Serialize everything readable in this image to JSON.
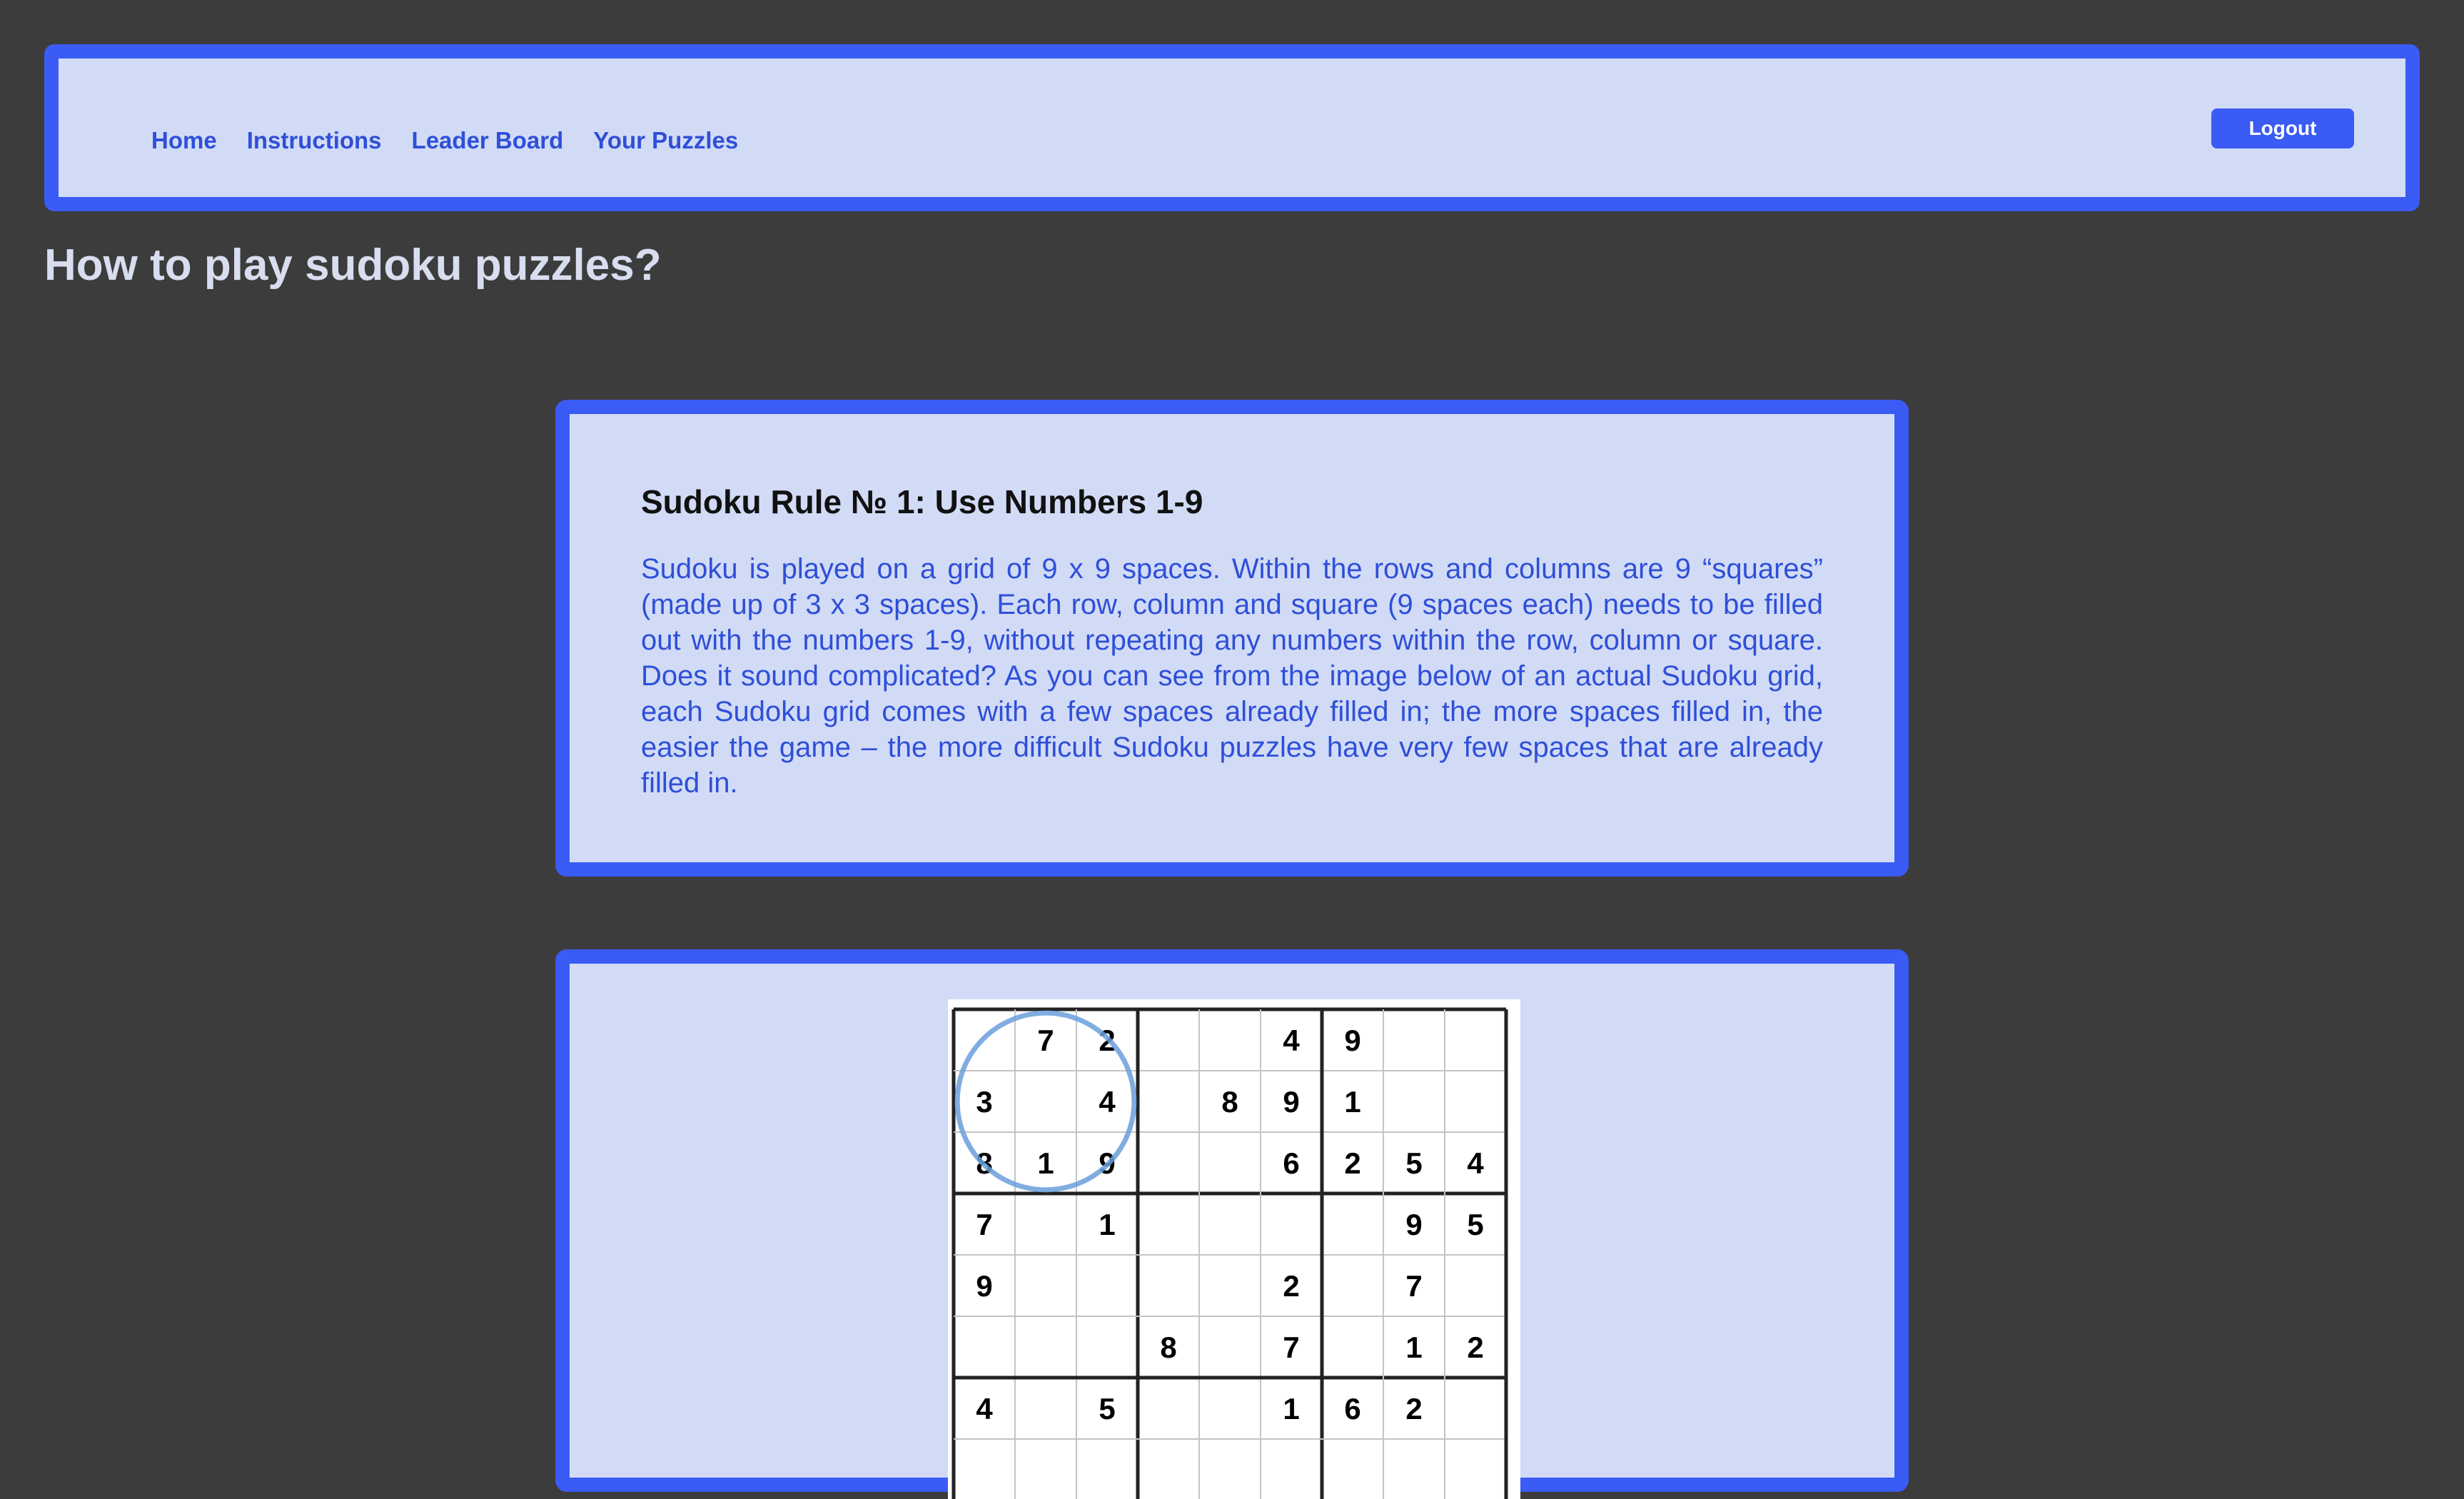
{
  "nav": {
    "links": [
      "Home",
      "Instructions",
      "Leader Board",
      "Your Puzzles"
    ],
    "logout_label": "Logout"
  },
  "page": {
    "title": "How to play sudoku puzzles?"
  },
  "rule1": {
    "title": "Sudoku Rule № 1: Use Numbers 1-9",
    "text": "Sudoku is played on a grid of 9 x 9 spaces. Within the rows and columns are 9 “squares” (made up of 3 x 3 spaces). Each row, column and square (9 spaces each) needs to be filled out with the numbers 1-9, without repeating any numbers within the row, column or square. Does it sound complicated? As you can see from the image below of an actual Sudoku grid, each Sudoku grid comes with a few spaces already filled in; the more spaces filled in, the easier the game – the more difficult Sudoku puzzles have very few spaces that are already filled in."
  },
  "sudoku": {
    "rows": [
      [
        "",
        "7",
        "2",
        "",
        "",
        "4",
        "9",
        "",
        ""
      ],
      [
        "3",
        "",
        "4",
        "",
        "8",
        "9",
        "1",
        "",
        ""
      ],
      [
        "8",
        "1",
        "9",
        "",
        "",
        "6",
        "2",
        "5",
        "4"
      ],
      [
        "7",
        "",
        "1",
        "",
        "",
        "",
        "",
        "9",
        "5"
      ],
      [
        "9",
        "",
        "",
        "",
        "",
        "2",
        "",
        "7",
        ""
      ],
      [
        "",
        "",
        "",
        "8",
        "",
        "7",
        "",
        "1",
        "2"
      ],
      [
        "4",
        "",
        "5",
        "",
        "",
        "1",
        "6",
        "2",
        ""
      ]
    ],
    "highlight_color": "#6a9fdc"
  }
}
